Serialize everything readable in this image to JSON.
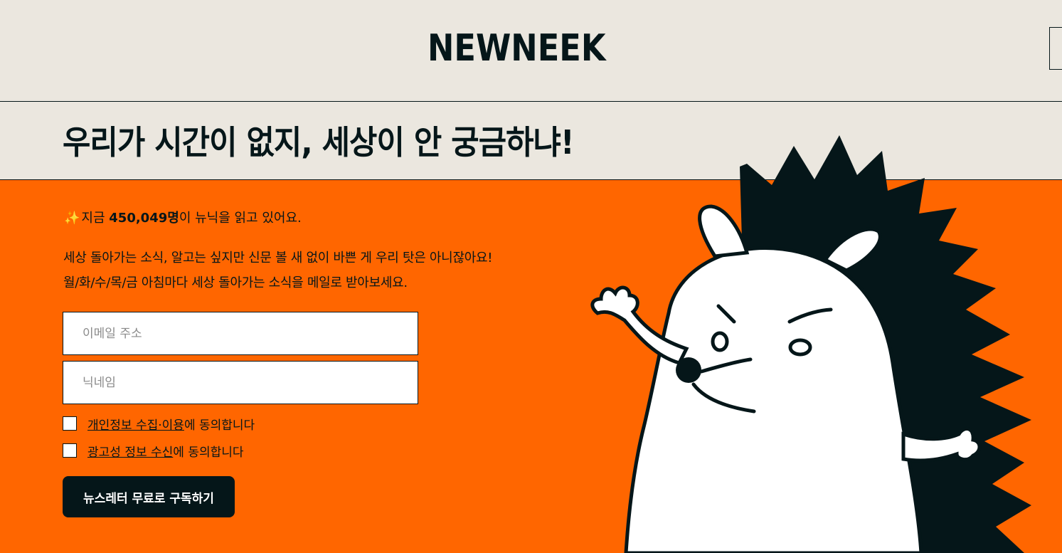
{
  "header": {
    "logo": "NEWNEEK"
  },
  "headline": "우리가 시간이 없지, 세상이 안 궁금하냐!",
  "counter": {
    "prefix": "지금 ",
    "count": "450,049명",
    "suffix": "이 뉴닉을 읽고 있어요."
  },
  "description": {
    "line1": "세상 돌아가는 소식, 알고는 싶지만 신문 볼 새 없이 바쁜 게 우리 탓은 아니잖아요!",
    "line2": "월/화/수/목/금 아침마다 세상 돌아가는 소식을 메일로 받아보세요."
  },
  "form": {
    "email_placeholder": "이메일 주소",
    "nickname_placeholder": "닉네임",
    "privacy_link": "개인정보 수집·이용",
    "privacy_suffix": "에 동의합니다",
    "ads_link": "광고성 정보 수신",
    "ads_suffix": "에 동의합니다",
    "submit_label": "뉴스레터 무료로 구독하기"
  },
  "colors": {
    "accent": "#ff6600",
    "background": "#ebe7df",
    "ink": "#051619"
  }
}
